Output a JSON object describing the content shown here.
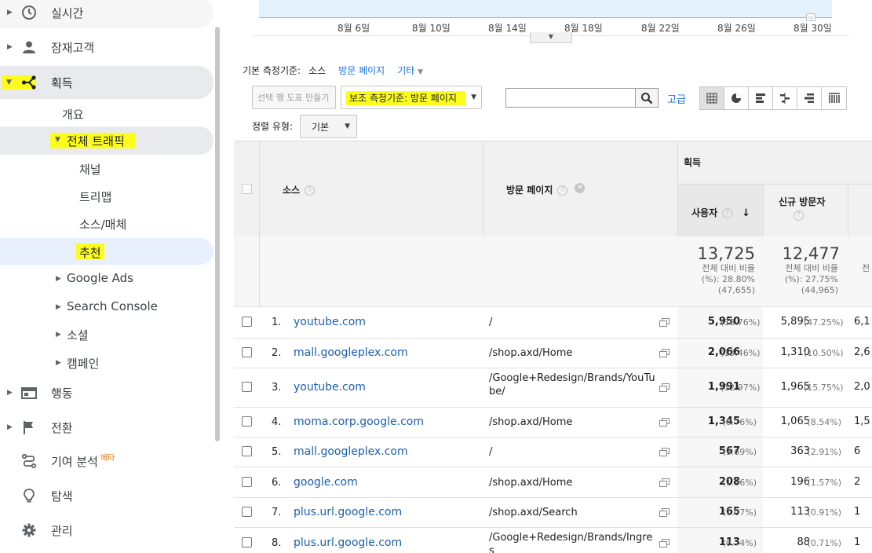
{
  "sidebar": {
    "items": [
      {
        "label": "실시간",
        "icon": "clock-icon"
      },
      {
        "label": "잠재고객",
        "icon": "person-icon"
      },
      {
        "label": "획득",
        "icon": "acquisition-icon"
      },
      {
        "label": "행동",
        "icon": "behavior-icon"
      },
      {
        "label": "전환",
        "icon": "flag-icon"
      },
      {
        "label": "기여 분석",
        "icon": "attribution-icon",
        "badge": "베타"
      },
      {
        "label": "탐색",
        "icon": "lightbulb-icon"
      },
      {
        "label": "관리",
        "icon": "gear-icon"
      }
    ],
    "acquisition_sub": {
      "overview": "개요",
      "all_traffic": "전체 트래픽",
      "all_traffic_children": [
        "채널",
        "트리맵",
        "소스/매체",
        "추천"
      ],
      "google_ads": "Google Ads",
      "search_console": "Search Console",
      "social": "소셜",
      "campaigns": "캠페인"
    }
  },
  "chart": {
    "x_ticks": [
      "8월 6일",
      "8월 10일",
      "8월 14일",
      "8월 18일",
      "8월 22일",
      "8월 26일",
      "8월 30일"
    ]
  },
  "dimensions": {
    "label": "기본 측정기준:",
    "selected": "소스",
    "option1": "방문 페이지",
    "other": "기타"
  },
  "toolbar": {
    "create_pivot": "선택 행 도표 만들기",
    "secondary_dimension": "보조 측정기준: 방문 페이지",
    "search_placeholder": "",
    "advanced": "고급",
    "sort_label": "정렬 유형:",
    "sort_value": "기본"
  },
  "table": {
    "group_header": "획득",
    "col_source": "소스",
    "col_landing": "방문 페이지",
    "col_users": "사용자",
    "col_new_users": "신규 방문자",
    "totals": {
      "users": "13,725",
      "users_pct_label": "전체 대비 비율",
      "users_pct": "(%): 28.80%",
      "users_of": "(47,655)",
      "new_users": "12,477",
      "new_users_pct_label": "전체 대비 비율",
      "new_users_pct": "(%): 27.75%",
      "new_users_of": "(44,965)",
      "clipped": "전"
    },
    "rows": [
      {
        "num": "1.",
        "source": "youtube.com",
        "page": "/",
        "users": "5,950",
        "users_pct": "(38.76%)",
        "new": "5,895",
        "new_pct": "(47.25%)",
        "extra": "6,1"
      },
      {
        "num": "2.",
        "source": "mall.googleplex.com",
        "page": "/shop.axd/Home",
        "users": "2,066",
        "users_pct": "(13.46%)",
        "new": "1,310",
        "new_pct": "(10.50%)",
        "extra": "2,6"
      },
      {
        "num": "3.",
        "source": "youtube.com",
        "page": "/Google+Redesign/Brands/YouTube/",
        "users": "1,991",
        "users_pct": "(12.97%)",
        "new": "1,965",
        "new_pct": "(15.75%)",
        "extra": "2,0"
      },
      {
        "num": "4.",
        "source": "moma.corp.google.com",
        "page": "/shop.axd/Home",
        "users": "1,345",
        "users_pct": "(8.76%)",
        "new": "1,065",
        "new_pct": "(8.54%)",
        "extra": "1,5"
      },
      {
        "num": "5.",
        "source": "mall.googleplex.com",
        "page": "/",
        "users": "567",
        "users_pct": "(3.69%)",
        "new": "363",
        "new_pct": "(2.91%)",
        "extra": "6"
      },
      {
        "num": "6.",
        "source": "google.com",
        "page": "/shop.axd/Home",
        "users": "208",
        "users_pct": "(1.36%)",
        "new": "196",
        "new_pct": "(1.57%)",
        "extra": "2"
      },
      {
        "num": "7.",
        "source": "plus.url.google.com",
        "page": "/shop.axd/Search",
        "users": "165",
        "users_pct": "(1.07%)",
        "new": "113",
        "new_pct": "(0.91%)",
        "extra": "1"
      },
      {
        "num": "8.",
        "source": "plus.url.google.com",
        "page": "/Google+Redesign/Brands/Ingres",
        "users": "113",
        "users_pct": "(0.74%)",
        "new": "88",
        "new_pct": "(0.71%)",
        "extra": "1"
      }
    ]
  },
  "colors": {
    "highlight": "#fcfc1e",
    "link": "#1a73e8",
    "selected_bg": "#e8eaed",
    "chart_fill": "#e3f2fd"
  }
}
